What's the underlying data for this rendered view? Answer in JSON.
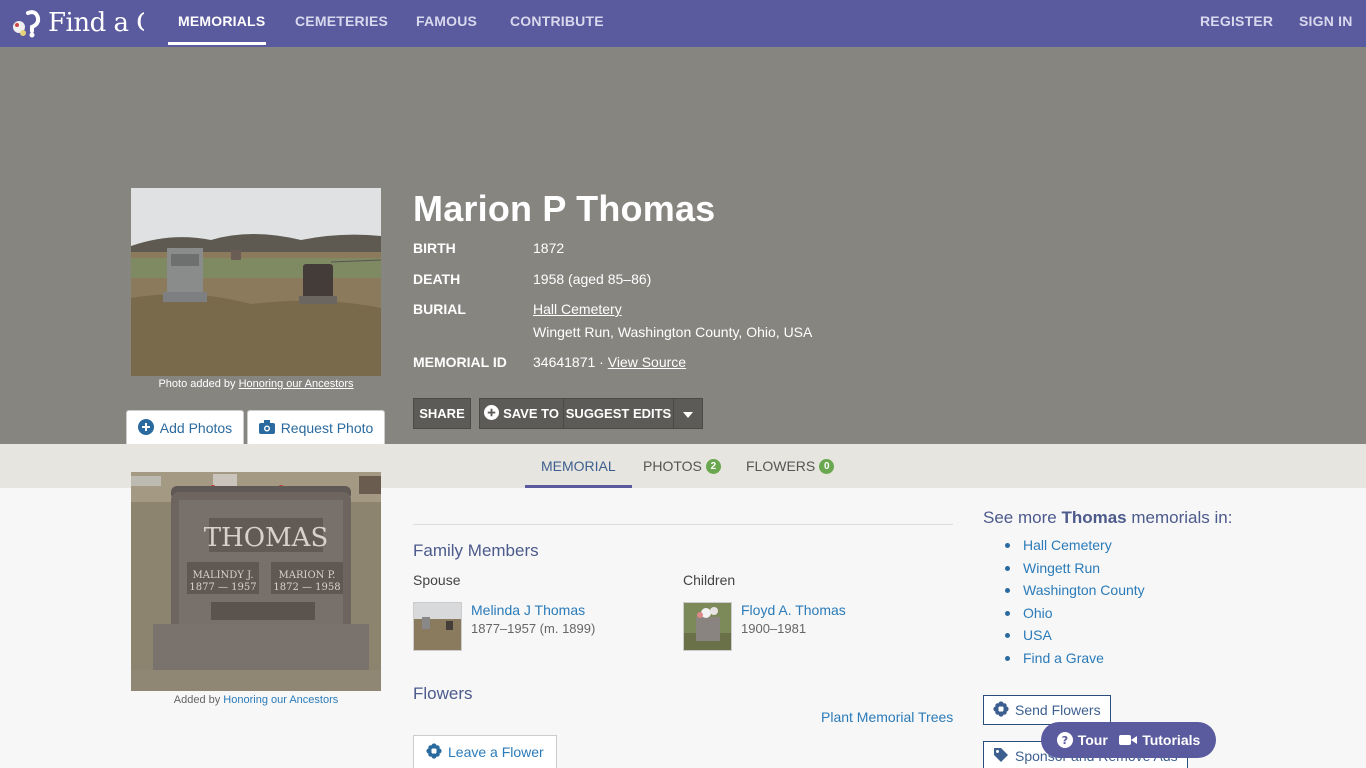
{
  "nav": {
    "logo_text": "Find a Gra",
    "items": [
      "MEMORIALS",
      "CEMETERIES",
      "FAMOUS",
      "CONTRIBUTE"
    ],
    "register": "REGISTER",
    "sign_in": "SIGN IN"
  },
  "hero": {
    "photo_caption_prefix": "Photo added by",
    "photo_caption_link": "Honoring our Ancestors",
    "add_photos": "Add Photos",
    "request_photo": "Request Photo",
    "name": "Marion P Thomas",
    "birth_label": "BIRTH",
    "birth_value": "1872",
    "death_label": "DEATH",
    "death_value": "1958 (aged 85–86)",
    "burial_label": "BURIAL",
    "burial_cemetery": "Hall Cemetery",
    "burial_location": "Wingett Run, Washington County, Ohio, USA",
    "memorial_id_label": "MEMORIAL ID",
    "memorial_id_value": "34641871 ·",
    "view_source": "View Source",
    "share": "SHARE",
    "save_to": "SAVE TO",
    "suggest_edits": "SUGGEST EDITS"
  },
  "tabs": {
    "memorial": "MEMORIAL",
    "photos": "PHOTOS",
    "photos_count": "2",
    "flowers": "FLOWERS",
    "flowers_count": "0"
  },
  "gravestone": {
    "caption_prefix": "Added by",
    "caption_link": "Honoring our Ancestors",
    "surname": "THOMAS",
    "left_name": "MALINDY J.",
    "left_dates": "1877 — 1957",
    "right_name": "MARION P.",
    "right_dates": "1872 — 1958"
  },
  "family": {
    "title": "Family Members",
    "spouse_label": "Spouse",
    "spouse_name": "Melinda J Thomas",
    "spouse_dates": "1877–1957 (m. 1899)",
    "children_label": "Children",
    "child_name": "Floyd A. Thomas",
    "child_dates": "1900–1981"
  },
  "flowers": {
    "title": "Flowers",
    "plant_trees": "Plant Memorial Trees",
    "leave_flower": "Leave a Flower"
  },
  "sidebar": {
    "see_more_prefix": "See more",
    "see_more_name": "Thomas",
    "see_more_suffix": "memorials in:",
    "links": [
      "Hall Cemetery",
      "Wingett Run",
      "Washington County",
      "Ohio",
      "USA",
      "Find a Grave"
    ],
    "send_flowers": "Send Flowers",
    "sponsor": "Sponsor and Remove Ads"
  },
  "help": {
    "tour": "Tour",
    "tutorials": "Tutorials"
  }
}
